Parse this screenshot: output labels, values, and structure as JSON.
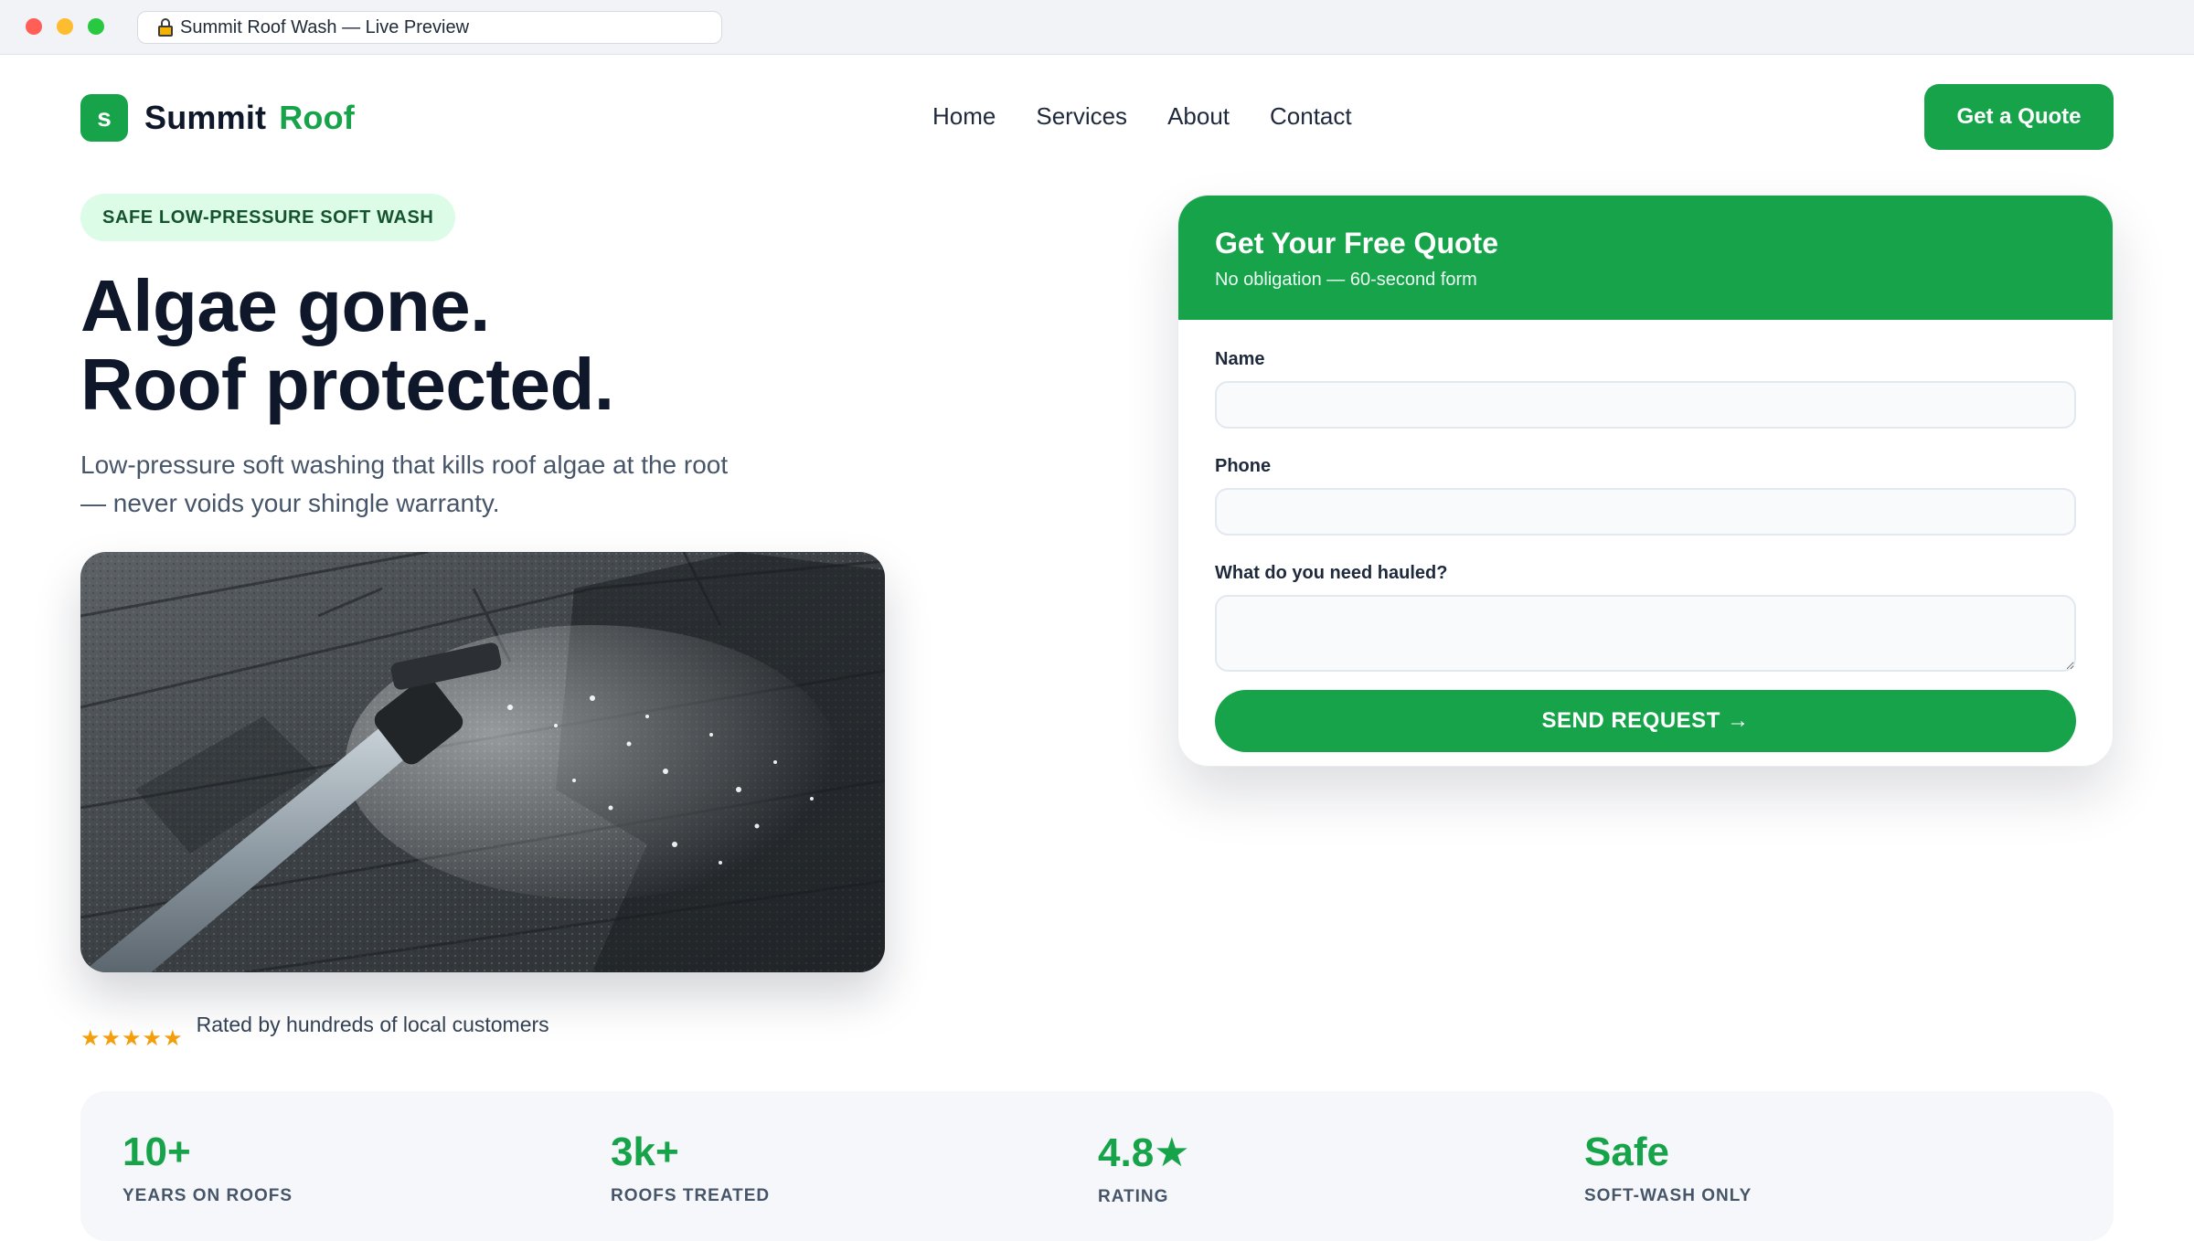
{
  "browser": {
    "tab_title": "Summit Roof Wash — Live Preview"
  },
  "logo": {
    "badge_letter": "s",
    "name_part1": "Summit",
    "name_part2": "Roof"
  },
  "nav": {
    "items": [
      "Home",
      "Services",
      "About",
      "Contact"
    ],
    "cta_label": "Get a Quote"
  },
  "hero": {
    "pill": "SAFE LOW-PRESSURE SOFT WASH",
    "headline_line1": "Algae gone.",
    "headline_line2": "Roof protected.",
    "subtext_line1": "Low-pressure soft washing that kills roof algae at the root",
    "subtext_line2": "— never voids your shingle warranty.",
    "image_description_icon": "roof-spray-photo",
    "stars": "★★★★★",
    "rating_text": "Rated by hundreds of local customers"
  },
  "quote_form": {
    "title": "Get Your Free Quote",
    "subtitle": "No obligation — 60-second form",
    "name_label": "Name",
    "name_value": "",
    "phone_label": "Phone",
    "phone_value": "",
    "need_label": "What do you need hauled?",
    "need_value": "",
    "submit_label": "SEND REQUEST →"
  },
  "stats": [
    {
      "value": "10+",
      "label": "YEARS ON ROOFS"
    },
    {
      "value": "3k+",
      "label": "ROOFS TREATED"
    },
    {
      "value": "4.8★",
      "label": "RATING"
    },
    {
      "value": "Safe",
      "label": "SOFT-WASH ONLY"
    }
  ],
  "colors": {
    "brand_green": "#16a34a",
    "pill_bg": "#dcfce7",
    "star": "#f59e0b",
    "heading": "#0f172a"
  }
}
